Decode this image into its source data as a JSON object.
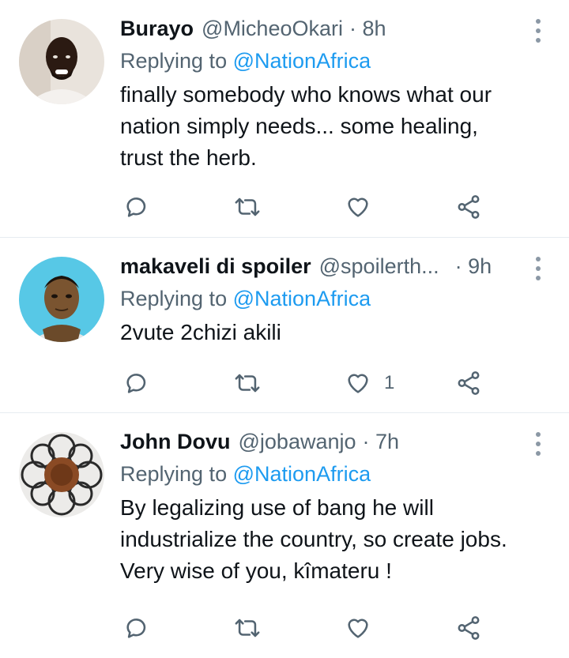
{
  "tweets": [
    {
      "name": "Burayo",
      "handle": "@MicheoOkari",
      "time": "· 8h",
      "replying_label": "Replying to",
      "replying_to": "@NationAfrica",
      "text_lines": [
        "finally somebody who knows what our",
        "nation simply needs... some healing,",
        "trust the herb."
      ],
      "like_count": ""
    },
    {
      "name": "makaveli di spoiler",
      "handle": "@spoilerth...",
      "time": "· 9h",
      "replying_label": "Replying to",
      "replying_to": "@NationAfrica",
      "text_lines": [
        "2vute 2chizi akili"
      ],
      "like_count": "1"
    },
    {
      "name": "John Dovu",
      "handle": "@jobawanjo",
      "time": "· 7h",
      "replying_label": "Replying to",
      "replying_to": "@NationAfrica",
      "text_lines": [
        "By legalizing use of bang he will",
        "industrialize the country, so create jobs.",
        "Very wise of you, kîmateru !"
      ],
      "like_count": ""
    }
  ],
  "icons": {
    "reply": "reply-icon",
    "retweet": "retweet-icon",
    "like": "heart-icon",
    "share": "share-icon",
    "more": "more-options-icon"
  },
  "colors": {
    "mention": "#1d9bf0",
    "secondary_text": "#536471",
    "divider": "#e6ecf0"
  }
}
